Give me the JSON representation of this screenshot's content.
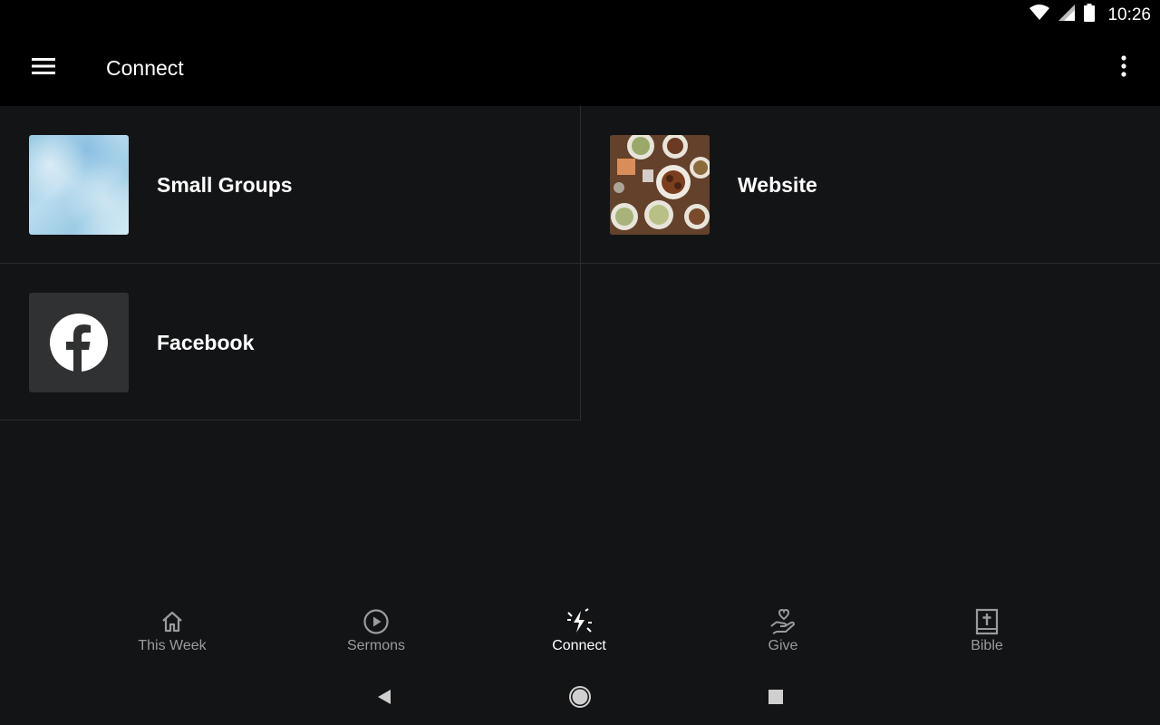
{
  "status_bar": {
    "time": "10:26",
    "icons": [
      "wifi-icon",
      "cell-signal-icon",
      "battery-icon"
    ]
  },
  "app_bar": {
    "title": "Connect",
    "menu_icon": "hamburger-menu-icon",
    "overflow_icon": "more-vert-icon"
  },
  "cards": [
    {
      "label": "Small Groups",
      "thumb": "sky-texture-image"
    },
    {
      "label": "Website",
      "thumb": "food-table-image"
    },
    {
      "label": "Facebook",
      "thumb": "facebook-logo"
    }
  ],
  "bottom_nav": [
    {
      "label": "This Week",
      "icon": "home-icon",
      "active": false
    },
    {
      "label": "Sermons",
      "icon": "play-circle-icon",
      "active": false
    },
    {
      "label": "Connect",
      "icon": "connect-bolt-icon",
      "active": true
    },
    {
      "label": "Give",
      "icon": "hand-heart-icon",
      "active": false
    },
    {
      "label": "Bible",
      "icon": "bible-icon",
      "active": false
    }
  ],
  "system_nav": [
    "back-icon",
    "home-circle-icon",
    "recents-square-icon"
  ],
  "colors": {
    "background": "#131416",
    "app_bar": "#000000",
    "divider": "#2c2d30",
    "inactive_label": "#9a9b9d",
    "active_label": "#ffffff"
  }
}
